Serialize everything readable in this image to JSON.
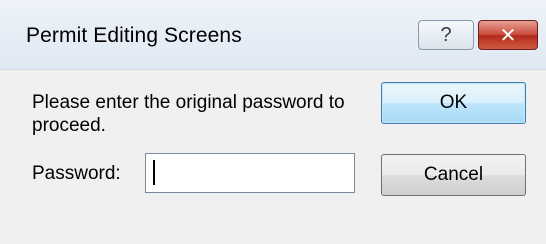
{
  "window": {
    "title": "Permit Editing Screens",
    "help_glyph": "?",
    "close_glyph": "✕"
  },
  "dialog": {
    "message": "Please enter the original password to proceed.",
    "password_label": "Password:",
    "password_value": "",
    "ok_label": "OK",
    "cancel_label": "Cancel"
  },
  "icons": {
    "help": "help-icon",
    "close": "close-icon"
  },
  "colors": {
    "titlebar": "#dfe8f3",
    "close_button": "#c9493a",
    "default_button_border": "#3c7fb1",
    "background": "#f0f0f0"
  }
}
